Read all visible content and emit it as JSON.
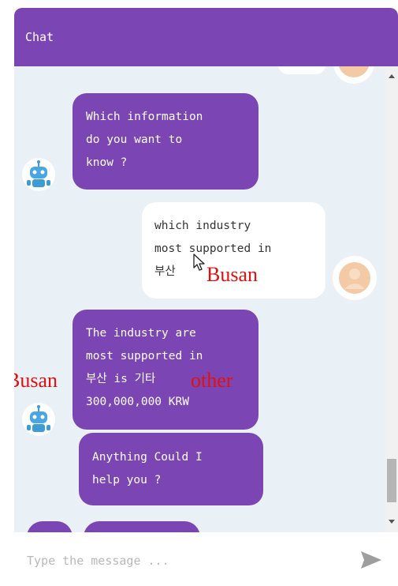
{
  "header": {
    "title": "Chat"
  },
  "messages": {
    "bot1": "Which information\ndo you want to\nknow ?",
    "user1": "which industry\nmost supported in\n부산",
    "bot2": "The industry are\nmost supported in\n부산 is 기타\n300,000,000 KRW",
    "bot3": "Anything Could I\nhelp you ?"
  },
  "annotations": {
    "busan1": "Busan",
    "busan2": "Busan",
    "other": "other"
  },
  "input": {
    "placeholder": "Type the message ..."
  },
  "colors": {
    "accent": "#7b46b3",
    "panel": "#e9f0f6",
    "annotation": "#e01010"
  },
  "icons": {
    "bot": "robot-icon",
    "user": "user-avatar-icon",
    "send": "send-icon",
    "cursor": "mouse-cursor-icon"
  }
}
